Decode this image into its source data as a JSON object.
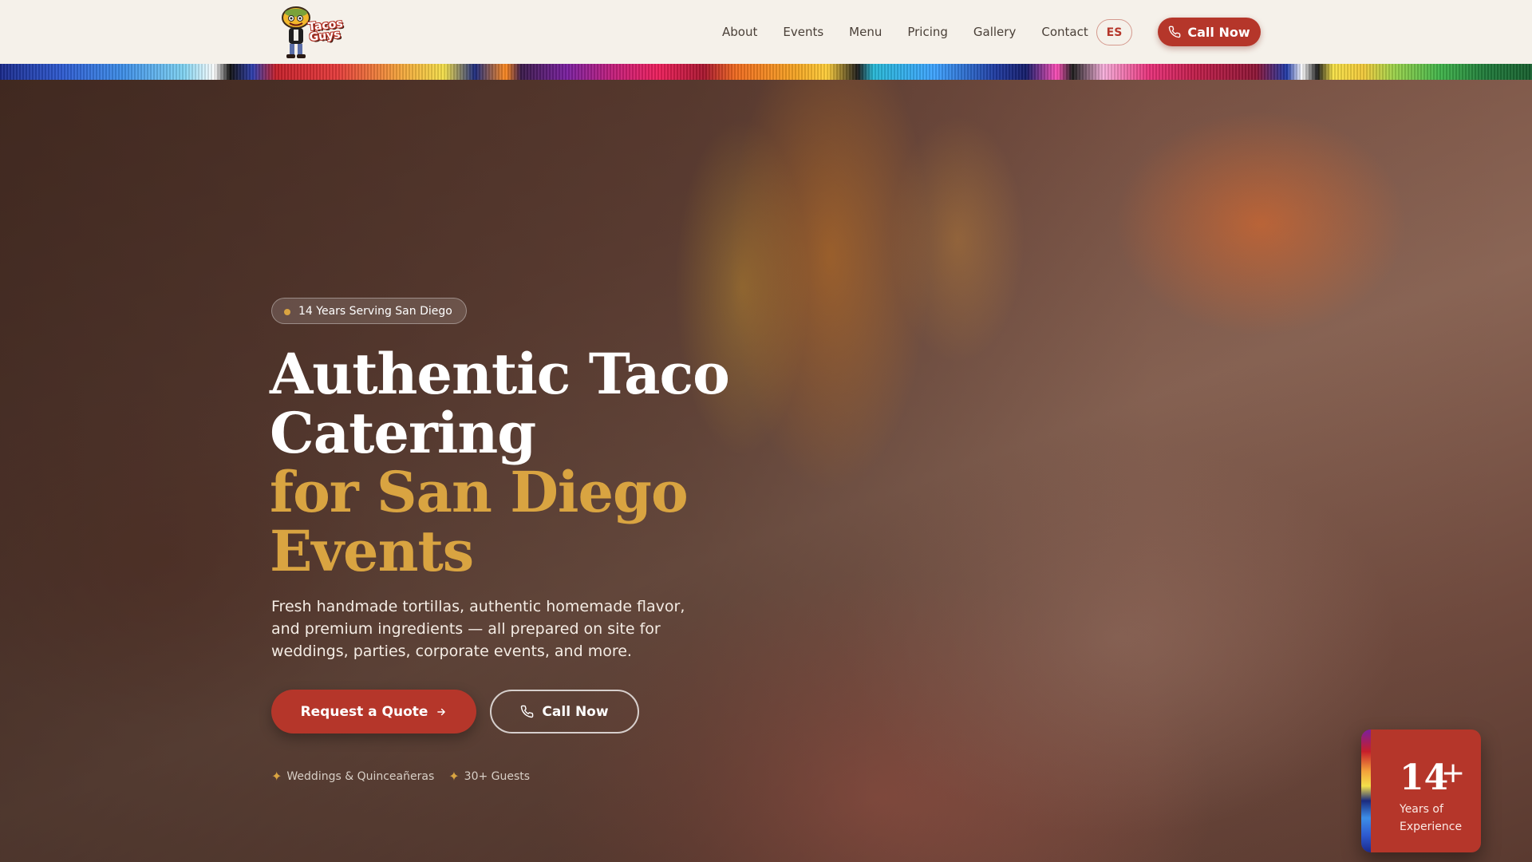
{
  "header": {
    "logo_text_line1": "Tacos",
    "logo_text_line2": "Guys",
    "nav": [
      "About",
      "Events",
      "Menu",
      "Pricing",
      "Gallery",
      "Contact"
    ],
    "lang_label": "ES",
    "call_label": "Call Now"
  },
  "hero": {
    "badge": "14 Years Serving San Diego",
    "headline_line1": "Authentic Taco",
    "headline_line2": "Catering",
    "headline_line3": "for San Diego",
    "headline_line4": "Events",
    "subtext": "Fresh handmade tortillas, authentic homemade flavor, and premium ingredients — all prepared on site for weddings, parties, corporate events, and more.",
    "quote_button": "Request a Quote",
    "call_button": "Call Now",
    "features": [
      "Weddings & Quinceañeras",
      "30+ Guests"
    ]
  },
  "experience_card": {
    "number": "14",
    "plus": "+",
    "label": "Years of Experience"
  },
  "colors": {
    "brand_red": "#b5362a",
    "accent_gold": "#d9a441",
    "header_bg": "#f5f1ea"
  },
  "icons": [
    "phone-icon",
    "arrow-right-icon",
    "sparkle-icon",
    "dot-icon",
    "taco-mascot-logo"
  ]
}
